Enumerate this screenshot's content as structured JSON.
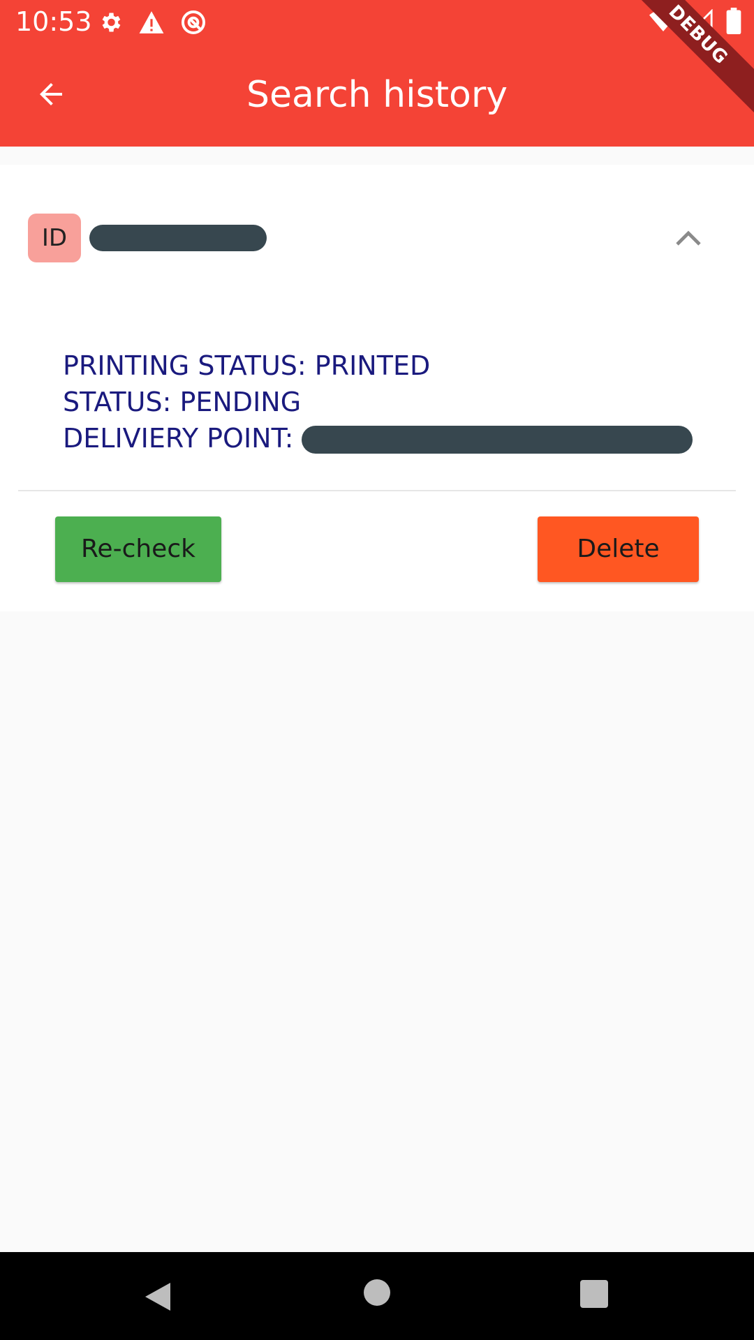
{
  "status_bar": {
    "time": "10:53",
    "icons_left": [
      "settings-icon",
      "warning-icon",
      "do-not-disturb-icon"
    ],
    "icons_right": [
      "wifi-icon",
      "signal-icon",
      "battery-icon"
    ],
    "debug_label": "DEBUG"
  },
  "app_bar": {
    "title": "Search history",
    "back_icon": "arrow-back-icon",
    "background": "#f44336"
  },
  "history_item": {
    "badge": "ID",
    "expand_icon": "chevron-up-icon",
    "details": {
      "printing_status": "PRINTING STATUS: PRINTED",
      "status": "STATUS: PENDING",
      "delivery_point_label": "DELIVIERY POINT: "
    },
    "recheck_label": "Re-check",
    "delete_label": "Delete",
    "colors": {
      "badge": "#f8a09a",
      "recheck": "#4caf50",
      "delete": "#ff5722",
      "details_text": "#1a1a7e"
    }
  },
  "nav_bar": {
    "buttons": [
      "nav-back-icon",
      "nav-home-icon",
      "nav-recents-icon"
    ]
  }
}
